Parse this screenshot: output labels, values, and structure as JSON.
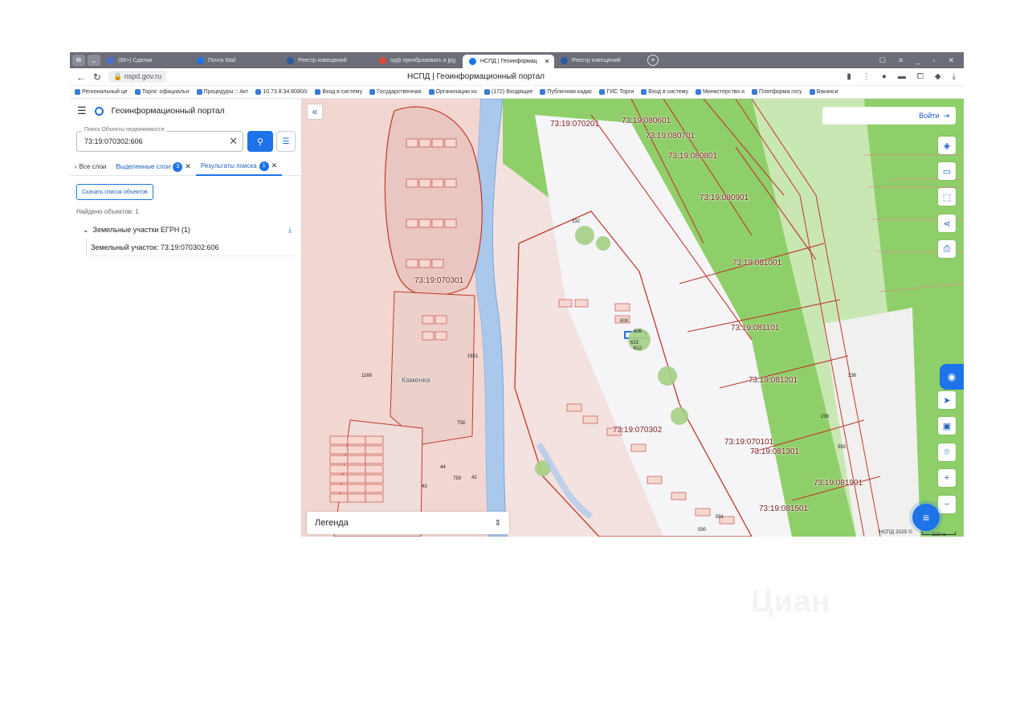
{
  "browser": {
    "tabs": [
      {
        "label": "(99+) Сделки",
        "color": "#4a6cd4"
      },
      {
        "label": "Почта Mail",
        "color": "#1e73e8"
      },
      {
        "label": "Реестр извещений",
        "color": "#2c5aa0"
      },
      {
        "label": "пдф преобразовать в jpg",
        "color": "#e04a3a"
      },
      {
        "label": "НСПД | Геоинформац",
        "color": "#1e73e8",
        "active": true
      },
      {
        "label": "Реестр извещений",
        "color": "#2c5aa0"
      }
    ],
    "new_tab": "+",
    "url": "nspd.gov.ru",
    "page_title": "НСПД | Геоинформационный портал",
    "window_controls": [
      "☐",
      "≡",
      "_",
      "▫",
      "✕"
    ]
  },
  "bookmarks": [
    "Региональный це",
    "Торги: официальн",
    "Процедуры :: Акт",
    "10.73.8.34:8080/c",
    "Вход в систему",
    "Государственная",
    "Организации ко",
    "(172) Входящие",
    "Публичная кадас",
    "ГИС Торги",
    "Вход в систему",
    "Министерство и",
    "Платформа госу",
    "Ваканси"
  ],
  "sidebar": {
    "title": "Геоинформационный портал",
    "search": {
      "label": "Поиск Объекты недвижимости",
      "value": "73:19:070302:606"
    },
    "tabs": [
      {
        "label": "Все слои"
      },
      {
        "label": "Выделенные слои",
        "badge": "3"
      },
      {
        "label": "Результаты поиска",
        "badge": "1"
      }
    ],
    "download_list": "Скачать список объектов",
    "found_text": "Найдено объектов: 1",
    "group_label": "Земельные участки ЕГРН (1)",
    "result_label": "Земельный участок: 73:19:070302:606"
  },
  "map": {
    "login_label": "Войти",
    "legend_label": "Легенда",
    "scale_label": "100 м",
    "copyright": "НСПД 2025 ©",
    "labels": [
      "73:19:070201",
      "73:19:080601",
      "73:19:080701",
      "73:19:080801",
      "73:19:080901",
      "73:19:081001",
      "73:19:081101",
      "73:19:081201",
      "73:19:070101",
      "73:19:081301",
      "73:19:081901",
      "73:19:081501",
      "73:19:070302",
      "73:19:070301",
      "Каменка"
    ],
    "parcels": [
      "1651",
      "1166",
      "758",
      "606",
      "608",
      "613",
      "612",
      "332",
      "591",
      "590",
      "593",
      "236",
      "238",
      "759",
      "44",
      "43",
      "42"
    ]
  },
  "watermark": "Циан"
}
